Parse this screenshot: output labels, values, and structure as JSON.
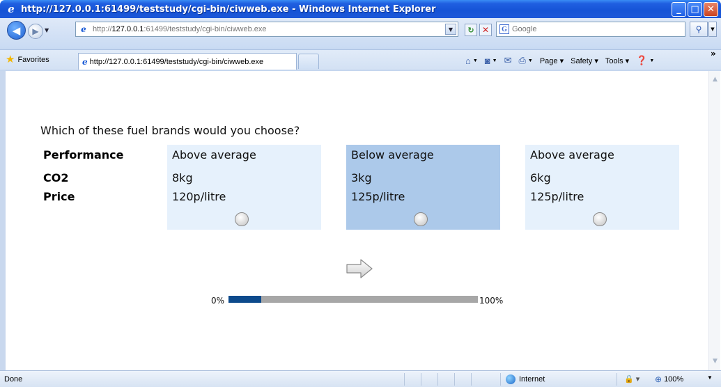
{
  "window": {
    "title": "http://127.0.0.1:61499/teststudy/cgi-bin/ciwweb.exe - Windows Internet Explorer"
  },
  "address": {
    "url_prefix": "http://",
    "url_host": "127.0.0.1",
    "url_rest": ":61499/teststudy/cgi-bin/ciwweb.exe",
    "search_placeholder": "Google"
  },
  "favorites": {
    "label": "Favorites",
    "tab_title": "http://127.0.0.1:61499/teststudy/cgi-bin/ciwweb.exe"
  },
  "commandbar": {
    "page": "Page",
    "safety": "Safety",
    "tools": "Tools"
  },
  "survey": {
    "question": "Which of these fuel brands would you choose?",
    "attributes": [
      "Performance",
      "CO2",
      "Price"
    ],
    "options": [
      {
        "performance": "Above average",
        "co2": "8kg",
        "price": "120p/litre",
        "selected": false
      },
      {
        "performance": "Below average",
        "co2": "3kg",
        "price": "125p/litre",
        "selected": true
      },
      {
        "performance": "Above average",
        "co2": "6kg",
        "price": "125p/litre",
        "selected": false
      }
    ],
    "progress": {
      "min_label": "0%",
      "max_label": "100%",
      "fraction": 0.13
    }
  },
  "status": {
    "text": "Done",
    "zone": "Internet",
    "zoom": "100%"
  },
  "colors": {
    "option_bg": "#e6f1fc",
    "option_selected_bg": "#acc9ea",
    "progress_fill": "#0d4a8c",
    "progress_track": "#a7a7a7"
  }
}
